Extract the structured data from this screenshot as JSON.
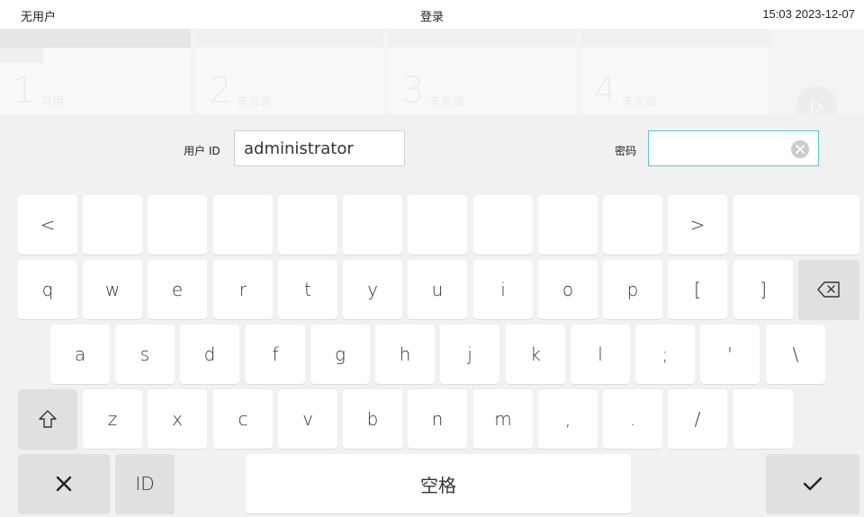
{
  "topbar": {
    "user": "无用户",
    "title": "登录",
    "time": "15:03",
    "date": "2023-12-07"
  },
  "modules": [
    {
      "number": "1",
      "status": "可用"
    },
    {
      "number": "2",
      "status": "未安装"
    },
    {
      "number": "3",
      "status": "未安装"
    },
    {
      "number": "4",
      "status": "未安装"
    }
  ],
  "login": {
    "user_id_label": "用户 ID",
    "user_id_value": "administrator",
    "password_label": "密码",
    "password_value": ""
  },
  "keyboard": {
    "row0": [
      "<",
      "",
      "",
      "",
      "",
      "",
      "",
      "",
      "",
      "",
      ">",
      ""
    ],
    "row1": [
      "q",
      "w",
      "e",
      "r",
      "t",
      "y",
      "u",
      "i",
      "o",
      "p",
      "[",
      "]"
    ],
    "row2": [
      "a",
      "s",
      "d",
      "f",
      "g",
      "h",
      "j",
      "k",
      "l",
      ";",
      "'",
      "\\"
    ],
    "row3": [
      "z",
      "x",
      "c",
      "v",
      "b",
      "n",
      "m",
      ",",
      ".",
      "/",
      ""
    ],
    "id_label": "ID",
    "space_label": "空格",
    "icons": {
      "backspace": "backspace-icon",
      "shift": "shift-icon",
      "close": "close-icon",
      "confirm": "check-icon",
      "clear": "clear-icon",
      "play": "play-icon"
    }
  },
  "colors": {
    "accent": "#5bc4d6",
    "key": "#ffffff",
    "dark_key": "#dfe1e1",
    "keyboard_bg": "#f1f1f1"
  }
}
